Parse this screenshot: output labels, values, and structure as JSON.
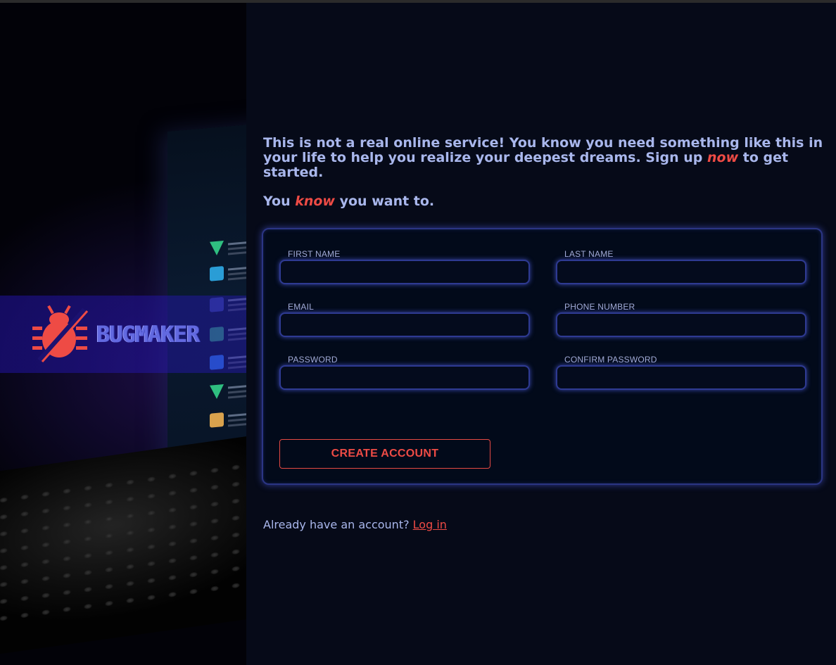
{
  "brand": {
    "name": "BUGMAKER",
    "logo_icon": "bug-icon",
    "colors": {
      "logo": "#ee4b45",
      "wordmark": "#6269e0",
      "band": "#2a16a8"
    }
  },
  "intro": {
    "part1": "This is not a real online service! You know you need something like this in your life to help you realize your deepest dreams. Sign up ",
    "emph1": "now",
    "part2": " to get started.",
    "line2_pre": "You ",
    "line2_emph": "know",
    "line2_post": " you want to."
  },
  "form": {
    "first_name": {
      "label": "FIRST NAME",
      "value": ""
    },
    "last_name": {
      "label": "LAST NAME",
      "value": ""
    },
    "email": {
      "label": "EMAIL",
      "value": ""
    },
    "phone": {
      "label": "PHONE NUMBER",
      "value": ""
    },
    "password": {
      "label": "PASSWORD",
      "value": ""
    },
    "confirm_password": {
      "label": "CONFIRM PASSWORD",
      "value": ""
    },
    "submit_label": "CREATE ACCOUNT"
  },
  "login": {
    "prompt": "Already have an account? ",
    "link": "Log in"
  },
  "colors": {
    "background": "#060a18",
    "text": "#a9b7ec",
    "accent": "#ee4b45",
    "field_border": "#2e3a92",
    "field_glow": "#5060e6"
  }
}
